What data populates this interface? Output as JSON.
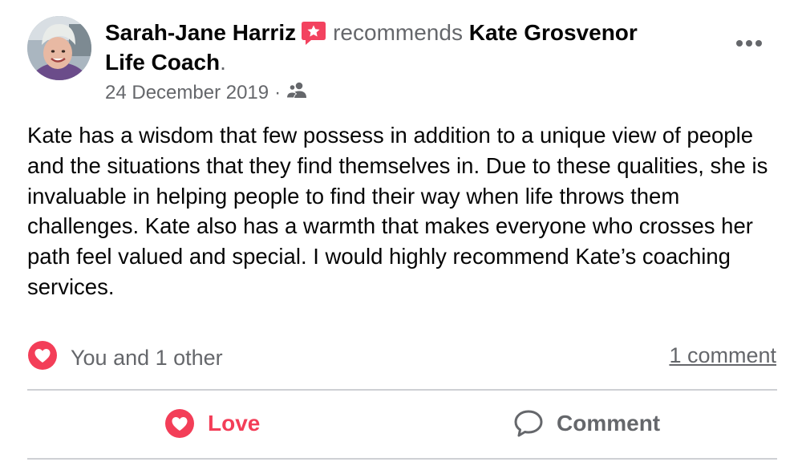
{
  "post": {
    "author": "Sarah-Jane Harriz",
    "verb": "recommends",
    "page_name_line1": "Kate Grosvenor",
    "page_name_line2": "Life Coach",
    "period": ".",
    "date": "24 December 2019",
    "separator": "·",
    "audience_icon": "friends-icon",
    "badge_icon": "recommendation-star-icon",
    "text": "Kate has a wisdom that few possess in addition to a unique view of people and the situations that they find themselves in. Due to these qualities, she is invaluable in helping people to find their way when life throws them challenges. Kate also has a warmth that makes everyone who crosses her path feel valued and special. I would highly recommend Kate’s coaching services."
  },
  "engagement": {
    "reaction_icon": "love-reaction-icon",
    "reaction_summary": "You and 1 other",
    "comments_count": "1 comment"
  },
  "actions": {
    "love_label": "Love",
    "comment_label": "Comment"
  },
  "colors": {
    "love": "#f33e58",
    "secondary_text": "#65676b",
    "primary_text": "#050505",
    "badge": "#f3425f",
    "divider": "#ced0d4"
  }
}
